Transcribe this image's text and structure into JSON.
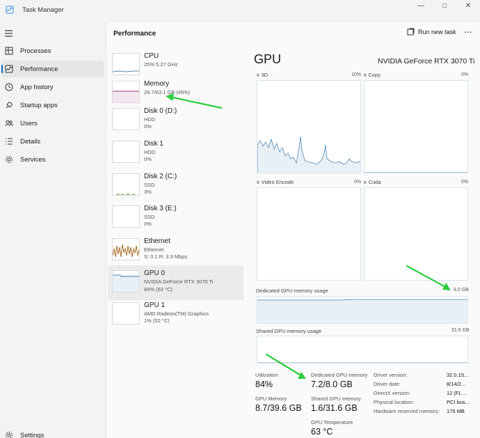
{
  "window": {
    "title": "Task Manager"
  },
  "nav": {
    "items": [
      {
        "label": "Processes"
      },
      {
        "label": "Performance"
      },
      {
        "label": "App history"
      },
      {
        "label": "Startup apps"
      },
      {
        "label": "Users"
      },
      {
        "label": "Details"
      },
      {
        "label": "Services"
      }
    ],
    "settings": "Settings"
  },
  "header": {
    "title": "Performance",
    "run_task": "Run new task"
  },
  "devices": [
    {
      "name": "CPU",
      "sub1": "25%  5.27 GHz",
      "sub2": ""
    },
    {
      "name": "Memory",
      "sub1": "28.7/63.1 GB (45%)",
      "sub2": ""
    },
    {
      "name": "Disk 0 (D:)",
      "sub1": "HDD",
      "sub2": "0%"
    },
    {
      "name": "Disk 1",
      "sub1": "HDD",
      "sub2": "0%"
    },
    {
      "name": "Disk 2 (C:)",
      "sub1": "SSD",
      "sub2": "3%"
    },
    {
      "name": "Disk 3 (E:)",
      "sub1": "SSD",
      "sub2": "0%"
    },
    {
      "name": "Ethernet",
      "sub1": "Ethernet",
      "sub2": "S: 0.1  R: 3.3 Mbps"
    },
    {
      "name": "GPU 0",
      "sub1": "NVIDIA GeForce RTX 3070 Ti",
      "sub2": "84%  (63 °C)"
    },
    {
      "name": "GPU 1",
      "sub1": "AMD Radeon(TM) Graphics",
      "sub2": "1%  (52 °C)"
    }
  ],
  "gpu": {
    "title": "GPU",
    "model": "NVIDIA GeForce RTX 3070 Ti",
    "engines": [
      {
        "label": "3D",
        "pct": "10%"
      },
      {
        "label": "Copy",
        "pct": "0%"
      },
      {
        "label": "Video Encode",
        "pct": "0%"
      },
      {
        "label": "Cuda",
        "pct": "0%"
      }
    ],
    "dedicated_label": "Dedicated GPU memory usage",
    "dedicated_max": "8.0 GB",
    "shared_label": "Shared GPU memory usage",
    "shared_max": "31.6 GB",
    "stats": {
      "utilization_label": "Utilization",
      "utilization": "84%",
      "dedicated_label": "Dedicated GPU memory",
      "dedicated": "7.2/8.0 GB",
      "gpu_mem_label": "GPU Memory",
      "gpu_mem": "8.7/39.6 GB",
      "shared_label": "Shared GPU memory",
      "shared": "1.6/31.6 GB",
      "temp_label": "GPU Temperature",
      "temp": "63 °C"
    },
    "info": [
      {
        "label": "Driver version:",
        "value": "32.0.15..."
      },
      {
        "label": "Driver date:",
        "value": "8/14/2..."
      },
      {
        "label": "DirectX version:",
        "value": "12 (FL ..."
      },
      {
        "label": "Physical location:",
        "value": "PCI bus..."
      },
      {
        "label": "Hardware reserved memory:",
        "value": "175 MB"
      }
    ]
  },
  "colors": {
    "accent": "#0067c0",
    "graph": "#4d87b3",
    "graph_fill": "#e8f0f6",
    "arrow": "#2ecc40"
  }
}
